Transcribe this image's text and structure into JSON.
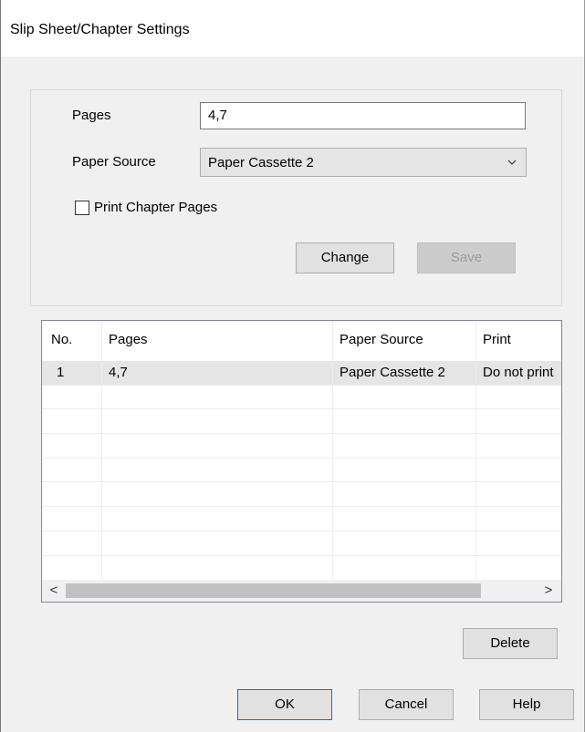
{
  "window": {
    "title": "Slip Sheet/Chapter Settings"
  },
  "form": {
    "pages_label": "Pages",
    "pages_value": "4,7",
    "paper_source_label": "Paper Source",
    "paper_source_value": "Paper Cassette 2",
    "print_chapter_label": "Print Chapter Pages",
    "print_chapter_checked": false,
    "change_label": "Change",
    "save_label": "Save"
  },
  "table": {
    "columns": [
      "No.",
      "Pages",
      "Paper Source",
      "Print"
    ],
    "rows": [
      {
        "no": "1",
        "pages": "4,7",
        "paper_source": "Paper Cassette 2",
        "print": "Do not print"
      }
    ]
  },
  "buttons": {
    "delete": "Delete",
    "ok": "OK",
    "cancel": "Cancel",
    "help": "Help"
  },
  "scrollbar": {
    "left_arrow": "<",
    "right_arrow": ">"
  },
  "colors": {
    "dialog_bg": "#f0f0f0",
    "selected_row": "#e5e5e5",
    "focus_border": "#0078d7"
  }
}
